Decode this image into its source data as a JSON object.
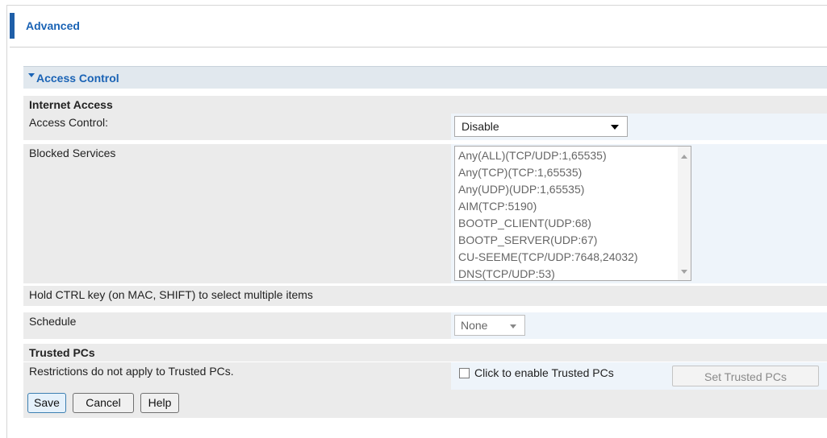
{
  "header": {
    "title": "Advanced"
  },
  "section": {
    "title": "Access Control"
  },
  "internet_access": {
    "heading": "Internet Access",
    "access_control_label": "Access Control:",
    "access_control_value": "Disable",
    "blocked_services_label": "Blocked Services",
    "services": [
      "Any(ALL)(TCP/UDP:1,65535)",
      "Any(TCP)(TCP:1,65535)",
      "Any(UDP)(UDP:1,65535)",
      "AIM(TCP:5190)",
      "BOOTP_CLIENT(UDP:68)",
      "BOOTP_SERVER(UDP:67)",
      "CU-SEEME(TCP/UDP:7648,24032)",
      "DNS(TCP/UDP:53)"
    ],
    "hint": "Hold CTRL key (on MAC, SHIFT) to select multiple items",
    "schedule_label": "Schedule",
    "schedule_value": "None"
  },
  "trusted_pcs": {
    "heading": "Trusted PCs",
    "description": "Restrictions do not apply to Trusted PCs.",
    "checkbox_label": "Click to enable Trusted PCs",
    "checkbox_checked": false,
    "set_button": "Set Trusted PCs"
  },
  "actions": {
    "save": "Save",
    "cancel": "Cancel",
    "help": "Help"
  },
  "colors": {
    "accent": "#1a63b5",
    "header_bar": "#1f5fa8",
    "row_left": "#ebebeb",
    "row_right": "#eef4fa"
  }
}
